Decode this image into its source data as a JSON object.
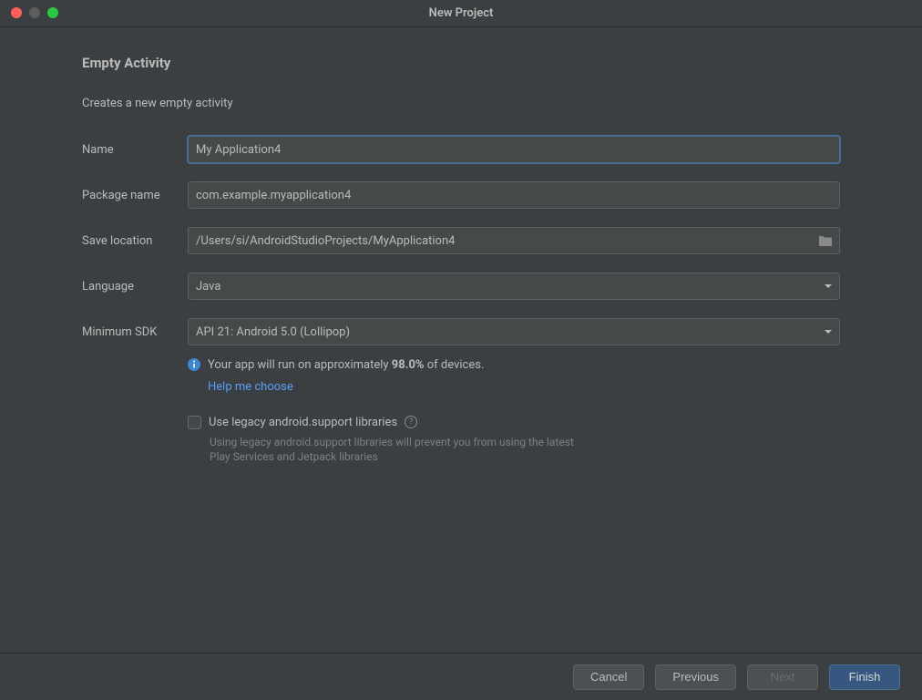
{
  "window": {
    "title": "New Project"
  },
  "page": {
    "heading": "Empty Activity",
    "description": "Creates a new empty activity"
  },
  "form": {
    "name": {
      "label": "Name",
      "value": "My Application4"
    },
    "package": {
      "label": "Package name",
      "value": "com.example.myapplication4"
    },
    "location": {
      "label": "Save location",
      "value": "/Users/si/AndroidStudioProjects/MyApplication4"
    },
    "language": {
      "label": "Language",
      "value": "Java"
    },
    "minsdk": {
      "label": "Minimum SDK",
      "value": "API 21: Android 5.0 (Lollipop)"
    }
  },
  "info": {
    "prefix": "Your app will run on approximately ",
    "percent": "98.0%",
    "suffix": " of devices.",
    "help_link": "Help me choose"
  },
  "legacy": {
    "checkbox_label": "Use legacy android.support libraries",
    "hint": "Using legacy android.support libraries will prevent you from using the latest Play Services and Jetpack libraries"
  },
  "footer": {
    "cancel": "Cancel",
    "previous": "Previous",
    "next": "Next",
    "finish": "Finish"
  }
}
